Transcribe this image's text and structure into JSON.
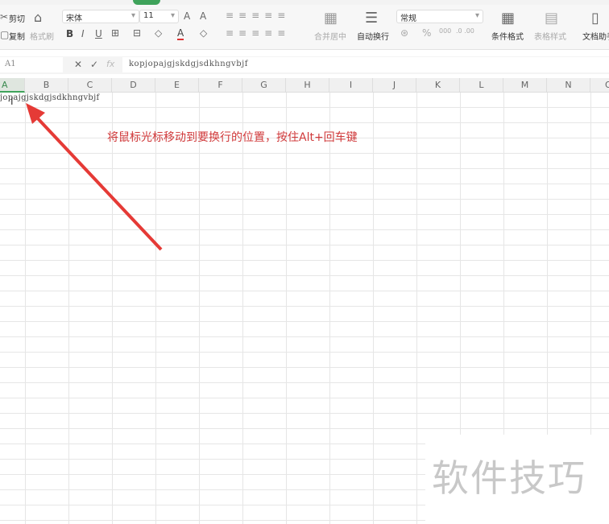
{
  "ribbon": {
    "cut": "剪切",
    "copy": "复制",
    "format_painter": "格式刷",
    "font_name": "宋体",
    "font_size": "11",
    "merge_center": "合并居中",
    "wrap_text": "自动换行",
    "number_format": "常规",
    "conditional_format": "条件格式",
    "table_style": "表格样式",
    "doc_assistant": "文档助手"
  },
  "formula_bar": {
    "cell_ref": "A1",
    "fx": "fx",
    "content": "kopjopajgjskdgjsdkhngvbjf"
  },
  "columns": [
    "A",
    "B",
    "C",
    "D",
    "E",
    "F",
    "G",
    "H",
    "I",
    "J",
    "K",
    "L",
    "M",
    "N",
    "O"
  ],
  "cell_a1": "jopajgjskdgjsdkhngvbjf",
  "annotation": "将鼠标光标移动到要换行的位置，按住Alt+回车键",
  "watermark": "软件技巧",
  "colors": {
    "accent": "#3fa35b",
    "annotation": "#d0393a"
  }
}
